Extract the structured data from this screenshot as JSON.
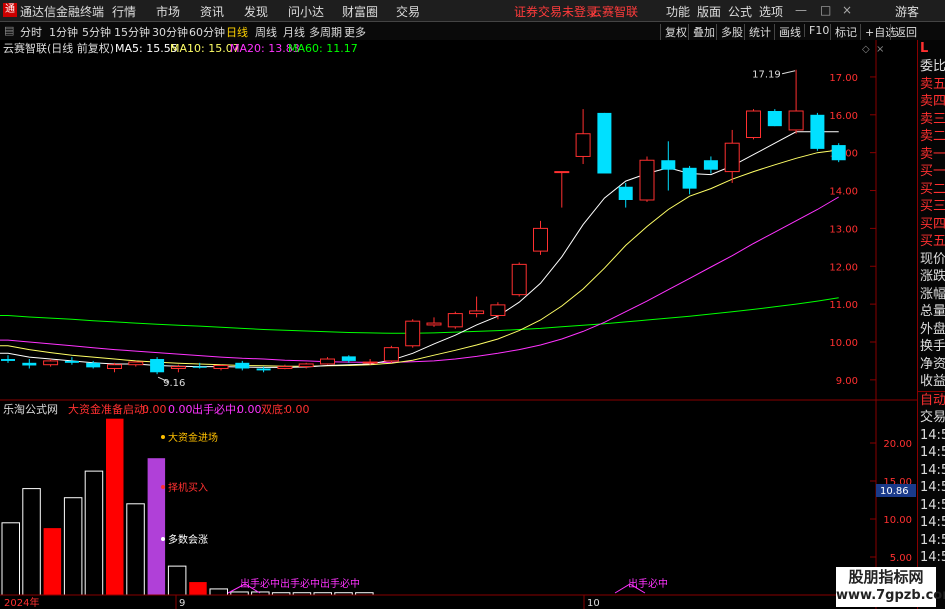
{
  "menubar": {
    "app_title": "通达信金融终端",
    "items": [
      "行情",
      "市场",
      "资讯",
      "发现",
      "问小达",
      "财富圈",
      "交易"
    ],
    "warning": "证券交易未登录",
    "stock_name": "云赛智联",
    "right_items": [
      "功能",
      "版面",
      "公式",
      "选项"
    ],
    "guest": "游客"
  },
  "toolbar": {
    "periods": [
      "分时",
      "1分钟",
      "5分钟",
      "15分钟",
      "30分钟",
      "60分钟",
      "日线",
      "周线",
      "月线",
      "多周期",
      "更多"
    ],
    "selected": "日线",
    "buttons": [
      "复权",
      "叠加",
      "多股",
      "统计",
      "画线",
      "F10",
      "标记",
      "+自选",
      "返回"
    ]
  },
  "price_panel": {
    "title": "云赛智联(日线 前复权)",
    "ma5": "MA5: 15.55",
    "ma10": "MA10: 15.07",
    "ma20": "MA20: 13.83",
    "ma60": "MA60: 11.17",
    "y_ticks": [
      "17.00",
      "16.00",
      "15.00",
      "14.00",
      "13.00",
      "12.00",
      "11.00",
      "10.00",
      "9.00"
    ],
    "high_label": "17.19",
    "low_label": "9.16",
    "colors": {
      "up": "#ff3030",
      "down": "#00e0ff",
      "ma5": "#ffffff",
      "ma10": "#ffff66",
      "ma20": "#ff33ff",
      "ma60": "#00ff00"
    }
  },
  "indicator_panel": {
    "title": "乐淘公式网",
    "items": [
      {
        "label": "大资金准备启动:",
        "value": "0.00",
        "color": "#ff3030"
      },
      {
        "label": "",
        "value": "0.00",
        "color": "#ff33ff"
      },
      {
        "label": "出手必中:",
        "value": "0.00",
        "color": "#ff33ff"
      },
      {
        "label": "双底:",
        "value": "0.00",
        "color": "#ff3030"
      }
    ],
    "y_ticks": [
      "20.00",
      "15.00",
      "10.00",
      "5.00"
    ],
    "current_value": "10.86",
    "annotations": [
      "大资金进场",
      "择机买入",
      "多数会涨",
      "出手必中出手必中出手必中",
      "出手必中"
    ]
  },
  "x_axis": {
    "labels": [
      "2024年",
      "9",
      "10"
    ]
  },
  "right_panel": {
    "top_badge": "L",
    "items": [
      "委比",
      "卖五",
      "卖四",
      "卖三",
      "卖二",
      "卖一",
      "买一",
      "买二",
      "买三",
      "买四",
      "买五",
      "现价",
      "涨跌",
      "涨幅",
      "总量",
      "外盘",
      "换手",
      "净资",
      "收益"
    ],
    "mode": "自动",
    "trade": "交易",
    "times": [
      "14:5",
      "14:5",
      "14:5",
      "14:5",
      "14:5",
      "14:5",
      "14:5",
      "14:5",
      "14:5",
      "14:5",
      "14:5",
      "14:5"
    ]
  },
  "watermark": {
    "line1": "股朋指标网",
    "line2": "www.7gpzb.com"
  },
  "chart_data": {
    "type": "candlestick",
    "ylim": [
      8.6,
      17.5
    ],
    "candles": [
      {
        "o": 9.55,
        "h": 9.65,
        "l": 9.45,
        "c": 9.5
      },
      {
        "o": 9.45,
        "h": 9.55,
        "l": 9.3,
        "c": 9.38
      },
      {
        "o": 9.4,
        "h": 9.55,
        "l": 9.35,
        "c": 9.5
      },
      {
        "o": 9.5,
        "h": 9.6,
        "l": 9.4,
        "c": 9.45
      },
      {
        "o": 9.45,
        "h": 9.5,
        "l": 9.3,
        "c": 9.33
      },
      {
        "o": 9.3,
        "h": 9.45,
        "l": 9.2,
        "c": 9.4
      },
      {
        "o": 9.4,
        "h": 9.5,
        "l": 9.35,
        "c": 9.47
      },
      {
        "o": 9.55,
        "h": 9.6,
        "l": 9.15,
        "c": 9.2
      },
      {
        "o": 9.3,
        "h": 9.4,
        "l": 9.2,
        "c": 9.35
      },
      {
        "o": 9.35,
        "h": 9.45,
        "l": 9.3,
        "c": 9.32
      },
      {
        "o": 9.3,
        "h": 9.4,
        "l": 9.25,
        "c": 9.38
      },
      {
        "o": 9.45,
        "h": 9.5,
        "l": 9.25,
        "c": 9.3
      },
      {
        "o": 9.3,
        "h": 9.35,
        "l": 9.2,
        "c": 9.25
      },
      {
        "o": 9.3,
        "h": 9.4,
        "l": 9.28,
        "c": 9.35
      },
      {
        "o": 9.35,
        "h": 9.45,
        "l": 9.3,
        "c": 9.42
      },
      {
        "o": 9.42,
        "h": 9.6,
        "l": 9.4,
        "c": 9.55
      },
      {
        "o": 9.62,
        "h": 9.65,
        "l": 9.45,
        "c": 9.5
      },
      {
        "o": 9.45,
        "h": 9.55,
        "l": 9.4,
        "c": 9.47
      },
      {
        "o": 9.5,
        "h": 9.9,
        "l": 9.45,
        "c": 9.85
      },
      {
        "o": 9.9,
        "h": 10.6,
        "l": 9.85,
        "c": 10.55
      },
      {
        "o": 10.45,
        "h": 10.65,
        "l": 10.4,
        "c": 10.5
      },
      {
        "o": 10.4,
        "h": 10.8,
        "l": 10.35,
        "c": 10.75
      },
      {
        "o": 10.75,
        "h": 11.2,
        "l": 10.65,
        "c": 10.82
      },
      {
        "o": 10.7,
        "h": 11.05,
        "l": 10.6,
        "c": 10.98
      },
      {
        "o": 11.25,
        "h": 12.1,
        "l": 11.2,
        "c": 12.05
      },
      {
        "o": 12.4,
        "h": 13.2,
        "l": 12.3,
        "c": 13.0
      },
      {
        "o": 14.5,
        "h": 14.5,
        "l": 13.55,
        "c": 14.5
      },
      {
        "o": 14.9,
        "h": 16.15,
        "l": 14.7,
        "c": 15.5
      },
      {
        "o": 16.05,
        "h": 16.05,
        "l": 14.5,
        "c": 14.45
      },
      {
        "o": 14.1,
        "h": 14.2,
        "l": 13.55,
        "c": 13.75
      },
      {
        "o": 13.75,
        "h": 14.9,
        "l": 13.7,
        "c": 14.8
      },
      {
        "o": 14.8,
        "h": 15.3,
        "l": 14.0,
        "c": 14.55
      },
      {
        "o": 14.6,
        "h": 14.65,
        "l": 13.9,
        "c": 14.05
      },
      {
        "o": 14.8,
        "h": 14.9,
        "l": 14.45,
        "c": 14.55
      },
      {
        "o": 14.5,
        "h": 15.6,
        "l": 14.2,
        "c": 15.25
      },
      {
        "o": 15.4,
        "h": 16.15,
        "l": 15.35,
        "c": 16.1
      },
      {
        "o": 16.1,
        "h": 16.15,
        "l": 15.7,
        "c": 15.7
      },
      {
        "o": 15.6,
        "h": 17.19,
        "l": 15.5,
        "c": 16.1
      },
      {
        "o": 16.0,
        "h": 16.05,
        "l": 15.05,
        "c": 15.1
      },
      {
        "o": 15.2,
        "h": 15.25,
        "l": 14.75,
        "c": 14.8
      }
    ],
    "ma5": [
      9.7,
      9.6,
      9.55,
      9.5,
      9.45,
      9.42,
      9.42,
      9.38,
      9.36,
      9.35,
      9.35,
      9.34,
      9.33,
      9.33,
      9.34,
      9.38,
      9.4,
      9.42,
      9.52,
      9.7,
      9.95,
      10.18,
      10.45,
      10.68,
      11.05,
      11.55,
      12.25,
      13.1,
      13.8,
      14.25,
      14.45,
      14.6,
      14.45,
      14.42,
      14.65,
      14.95,
      15.25,
      15.55,
      15.55,
      15.55
    ],
    "ma10": [
      9.9,
      9.8,
      9.72,
      9.65,
      9.6,
      9.55,
      9.5,
      9.47,
      9.44,
      9.42,
      9.4,
      9.38,
      9.37,
      9.36,
      9.36,
      9.37,
      9.38,
      9.4,
      9.44,
      9.52,
      9.65,
      9.78,
      9.92,
      10.08,
      10.3,
      10.58,
      10.95,
      11.4,
      11.95,
      12.55,
      13.05,
      13.5,
      13.85,
      14.05,
      14.3,
      14.5,
      14.68,
      14.85,
      15.0,
      15.07
    ],
    "ma20": [
      10.05,
      10.0,
      9.95,
      9.9,
      9.85,
      9.8,
      9.76,
      9.72,
      9.68,
      9.64,
      9.6,
      9.57,
      9.55,
      9.52,
      9.5,
      9.48,
      9.47,
      9.46,
      9.46,
      9.48,
      9.5,
      9.55,
      9.62,
      9.7,
      9.8,
      9.92,
      10.08,
      10.28,
      10.52,
      10.8,
      11.08,
      11.38,
      11.68,
      11.98,
      12.28,
      12.6,
      12.9,
      13.2,
      13.5,
      13.83
    ],
    "ma60": [
      10.7,
      10.66,
      10.63,
      10.6,
      10.56,
      10.53,
      10.5,
      10.47,
      10.44,
      10.42,
      10.39,
      10.36,
      10.33,
      10.31,
      10.29,
      10.27,
      10.25,
      10.24,
      10.23,
      10.23,
      10.24,
      10.26,
      10.28,
      10.3,
      10.33,
      10.36,
      10.4,
      10.44,
      10.48,
      10.53,
      10.58,
      10.63,
      10.68,
      10.74,
      10.8,
      10.86,
      10.93,
      11.0,
      11.08,
      11.17
    ],
    "bars": [
      {
        "v": 9.5,
        "c": "#ffffff"
      },
      {
        "v": 14.0,
        "c": "#ffffff"
      },
      {
        "v": 8.8,
        "c": "#ff0000"
      },
      {
        "v": 12.8,
        "c": "#ffffff"
      },
      {
        "v": 16.3,
        "c": "#ffffff"
      },
      {
        "v": 23.2,
        "c": "#ff0000"
      },
      {
        "v": 12.0,
        "c": "#ffffff"
      },
      {
        "v": 18.0,
        "c": "#b040d8"
      },
      {
        "v": 3.8,
        "c": "#ffffff"
      },
      {
        "v": 1.7,
        "c": "#ff0000"
      },
      {
        "v": 0.8,
        "c": "#ffffff"
      },
      {
        "v": 0.4,
        "c": "#ffffff"
      },
      {
        "v": 0.4,
        "c": "#ffffff"
      },
      {
        "v": 0.3,
        "c": "#ffffff"
      },
      {
        "v": 0.3,
        "c": "#ffffff"
      },
      {
        "v": 0.3,
        "c": "#ffffff"
      },
      {
        "v": 0.3,
        "c": "#ffffff"
      },
      {
        "v": 0.3,
        "c": "#ffffff"
      }
    ],
    "bar_ylim": [
      0,
      25
    ]
  }
}
